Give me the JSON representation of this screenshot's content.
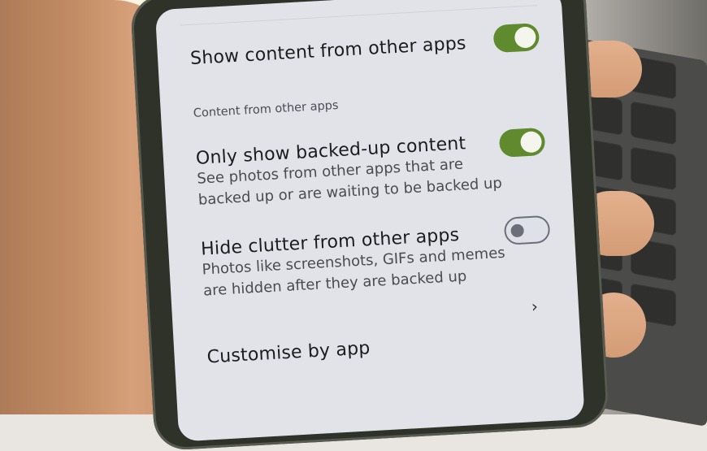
{
  "settings": {
    "show_content": {
      "label": "Show content from other apps",
      "enabled": true
    },
    "section_header": "Content from other apps",
    "backed_up": {
      "label": "Only show backed-up content",
      "description_line1": "See photos from other apps that are",
      "description_line2": "backed up or are waiting to be backed up",
      "enabled": true
    },
    "hide_clutter": {
      "label": "Hide clutter from other apps",
      "description_line1": "Photos like screenshots, GIFs and memes",
      "description_line2": "are hidden after they are backed up",
      "enabled": false
    },
    "customise": {
      "label": "Customise by app",
      "icon": "chevron-right-icon",
      "glyph": "›"
    }
  },
  "colors": {
    "toggle_on": "#5f8a2e",
    "toggle_off_border": "#6c6e7a",
    "screen_bg": "#e1e3e9"
  }
}
